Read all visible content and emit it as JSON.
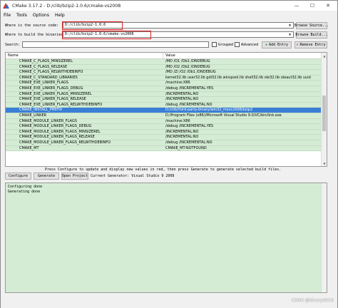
{
  "window": {
    "title": "CMake 3.17.2 - D:/clib/bzip2-1.0.6/cmake-vs2008",
    "minimize": "—",
    "maximize": "☐",
    "close": "✕"
  },
  "menu": [
    "File",
    "Tools",
    "Options",
    "Help"
  ],
  "source": {
    "label": "Where is the source code:",
    "value": "D:/clib/bzip2-1.0.6",
    "browse": "Browse Source..."
  },
  "build": {
    "label": "Where to build the binaries:",
    "value": "D:/clib/bzip2-1.0.6/cmake-vs2008",
    "browse": "Browse Build..."
  },
  "search": {
    "label": "Search:",
    "value": "",
    "grouped": "Grouped",
    "advanced": "Advanced",
    "add_entry": "Add Entry",
    "remove_entry": "Remove Entry"
  },
  "table": {
    "columns": [
      "Name",
      "Value"
    ],
    "rows": [
      {
        "name": "CMAKE_C_FLAGS_MINSIZEREL",
        "value": "/MD /O1 /Ob1 /DNDEBUG"
      },
      {
        "name": "CMAKE_C_FLAGS_RELEASE",
        "value": "/MD /O2 /Ob2 /DNDEBUG"
      },
      {
        "name": "CMAKE_C_FLAGS_RELWITHDEBINFO",
        "value": "/MD /Zi /O2 /Ob1 /DNDEBUG"
      },
      {
        "name": "CMAKE_C_STANDARD_LIBRARIES",
        "value": "kernel32.lib user32.lib gdi32.lib winspool.lib shell32.lib ole32.lib oleaut32.lib uuid"
      },
      {
        "name": "CMAKE_EXE_LINKER_FLAGS",
        "value": "/machine:X86"
      },
      {
        "name": "CMAKE_EXE_LINKER_FLAGS_DEBUG",
        "value": "/debug /INCREMENTAL:YES"
      },
      {
        "name": "CMAKE_EXE_LINKER_FLAGS_MINSIZEREL",
        "value": "/INCREMENTAL:NO"
      },
      {
        "name": "CMAKE_EXE_LINKER_FLAGS_RELEASE",
        "value": "/INCREMENTAL:NO"
      },
      {
        "name": "CMAKE_EXE_LINKER_FLAGS_RELWITHDEBINFO",
        "value": "/debug /INCREMENTAL:NO"
      },
      {
        "name": "CMAKE_INSTALL_PREFIX",
        "value": "D:/clib/third-party-binary/win32_msvc2008/bzip2",
        "selected": true
      },
      {
        "name": "CMAKE_LINKER",
        "value": "D:/Program Files (x86)/Microsoft Visual Studio 9.0/VC/bin/link.exe"
      },
      {
        "name": "CMAKE_MODULE_LINKER_FLAGS",
        "value": "/machine:X86"
      },
      {
        "name": "CMAKE_MODULE_LINKER_FLAGS_DEBUG",
        "value": "/debug /INCREMENTAL:YES"
      },
      {
        "name": "CMAKE_MODULE_LINKER_FLAGS_MINSIZEREL",
        "value": "/INCREMENTAL:NO"
      },
      {
        "name": "CMAKE_MODULE_LINKER_FLAGS_RELEASE",
        "value": "/INCREMENTAL:NO"
      },
      {
        "name": "CMAKE_MODULE_LINKER_FLAGS_RELWITHDEBINFO",
        "value": "/debug /INCREMENTAL:NO"
      },
      {
        "name": "CMAKE_MT",
        "value": "CMAKE_MT-NOTFOUND"
      }
    ]
  },
  "hint": "Press Configure to update and display new values in red, then press Generate to generate selected build files.",
  "actions": {
    "configure": "Configure",
    "generate": "Generate",
    "open_project": "Open Project",
    "generator": "Current Generator: Visual Studio 9 2008"
  },
  "output": [
    "Configuring done",
    "Generating done"
  ],
  "watermark": "CSDN @binary0010",
  "colors": {
    "row_bg": "#d4ecd4",
    "selected_row": "#3a7fd6",
    "highlight_box": "#e02020"
  }
}
